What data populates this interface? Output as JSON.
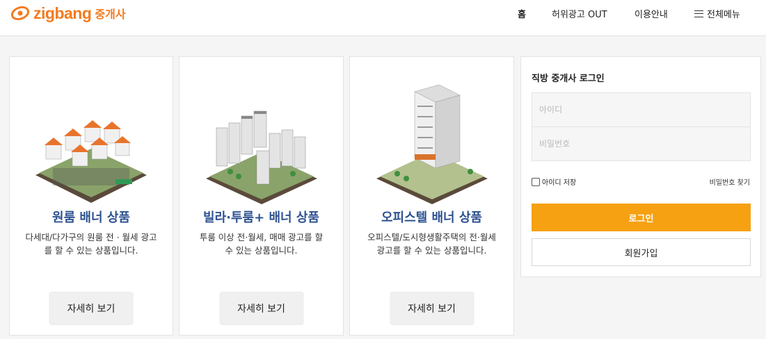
{
  "header": {
    "logo_text": "zigbang",
    "logo_sub": "중개사",
    "nav": {
      "home": "홈",
      "fake_ad": "허위광고 OUT",
      "guide": "이용안내",
      "menu": "전체메뉴"
    }
  },
  "cards": [
    {
      "title": "원룸 배너 상품",
      "desc": "다세대/다가구의 원룸 전 · 월세 광고를 할 수 있는 상품입니다.",
      "button": "자세히 보기"
    },
    {
      "title": "빌라·투룸+ 배너 상품",
      "desc": "투룸 이상 전·월세, 매매 광고를 할 수 있는 상품입니다.",
      "button": "자세히 보기"
    },
    {
      "title": "오피스텔 배너 상품",
      "desc": "오피스텔/도시형생활주택의 전·월세 광고를 할 수 있는 상품입니다.",
      "button": "자세히 보기"
    }
  ],
  "login": {
    "title": "직방 중개사 로그인",
    "id_placeholder": "아이디",
    "pw_placeholder": "비밀번호",
    "save_id": "아이디 저장",
    "find_pw": "비밀번호 찾기",
    "login_button": "로그인",
    "join_button": "회원가입"
  },
  "colors": {
    "brand": "#f47b20",
    "title_blue": "#2d5290",
    "login_orange": "#f6a112"
  }
}
